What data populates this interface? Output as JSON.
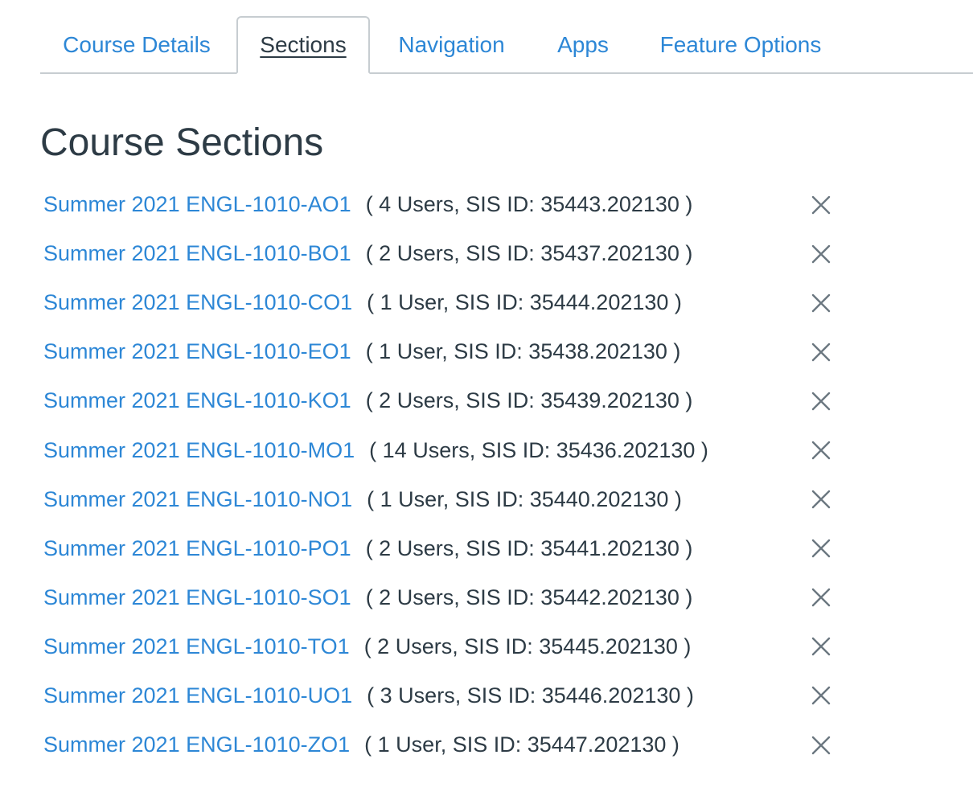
{
  "tabs": [
    {
      "label": "Course Details",
      "active": false
    },
    {
      "label": "Sections",
      "active": true
    },
    {
      "label": "Navigation",
      "active": false
    },
    {
      "label": "Apps",
      "active": false
    },
    {
      "label": "Feature Options",
      "active": false
    }
  ],
  "main": {
    "title": "Course Sections",
    "sections": [
      {
        "name": "Summer 2021 ENGL-1010-AO1",
        "meta": "( 4 Users, SIS ID: 35443.202130 )"
      },
      {
        "name": "Summer 2021 ENGL-1010-BO1",
        "meta": "( 2 Users, SIS ID: 35437.202130 )"
      },
      {
        "name": "Summer 2021 ENGL-1010-CO1",
        "meta": "( 1 User, SIS ID: 35444.202130 )"
      },
      {
        "name": "Summer 2021 ENGL-1010-EO1",
        "meta": "( 1 User, SIS ID: 35438.202130 )"
      },
      {
        "name": "Summer 2021 ENGL-1010-KO1",
        "meta": "( 2 Users, SIS ID: 35439.202130 )"
      },
      {
        "name": "Summer 2021 ENGL-1010-MO1",
        "meta": "( 14 Users, SIS ID: 35436.202130 )"
      },
      {
        "name": "Summer 2021 ENGL-1010-NO1",
        "meta": "( 1 User, SIS ID: 35440.202130 )"
      },
      {
        "name": "Summer 2021 ENGL-1010-PO1",
        "meta": "( 2 Users, SIS ID: 35441.202130 )"
      },
      {
        "name": "Summer 2021 ENGL-1010-SO1",
        "meta": "( 2 Users, SIS ID: 35442.202130 )"
      },
      {
        "name": "Summer 2021 ENGL-1010-TO1",
        "meta": "( 2 Users, SIS ID: 35445.202130 )"
      },
      {
        "name": "Summer 2021 ENGL-1010-UO1",
        "meta": "( 3 Users, SIS ID: 35446.202130 )"
      },
      {
        "name": "Summer 2021 ENGL-1010-ZO1",
        "meta": "( 1 User, SIS ID: 35447.202130 )"
      }
    ]
  },
  "icons": {
    "delete": "close-icon"
  },
  "colors": {
    "link": "#2d87d6",
    "text": "#2d3b45",
    "border": "#c7cdd1",
    "icon": "#6b7780"
  }
}
